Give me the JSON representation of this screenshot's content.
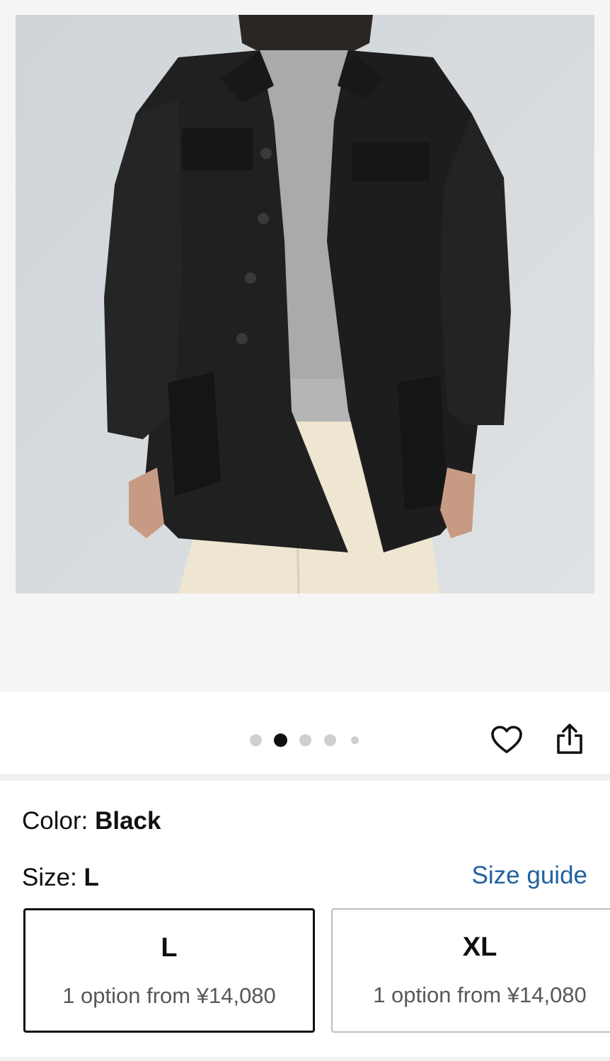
{
  "product": {
    "image_alt": "Man wearing black field jacket over grey sweater and cream trousers"
  },
  "gallery": {
    "dot_count": 5,
    "active_index": 1
  },
  "actions": {
    "favorite_icon": "heart-icon",
    "share_icon": "share-icon"
  },
  "color": {
    "label": "Color: ",
    "value": "Black"
  },
  "size": {
    "label": "Size: ",
    "value": "L",
    "guide_link": "Size guide",
    "options": [
      {
        "name": "L",
        "detail": "1 option from ¥14,080",
        "selected": true
      },
      {
        "name": "XL",
        "detail": "1 option from ¥14,080",
        "selected": false
      }
    ]
  },
  "colors": {
    "link": "#2162a1",
    "text": "#0f1111",
    "muted": "#565959"
  }
}
